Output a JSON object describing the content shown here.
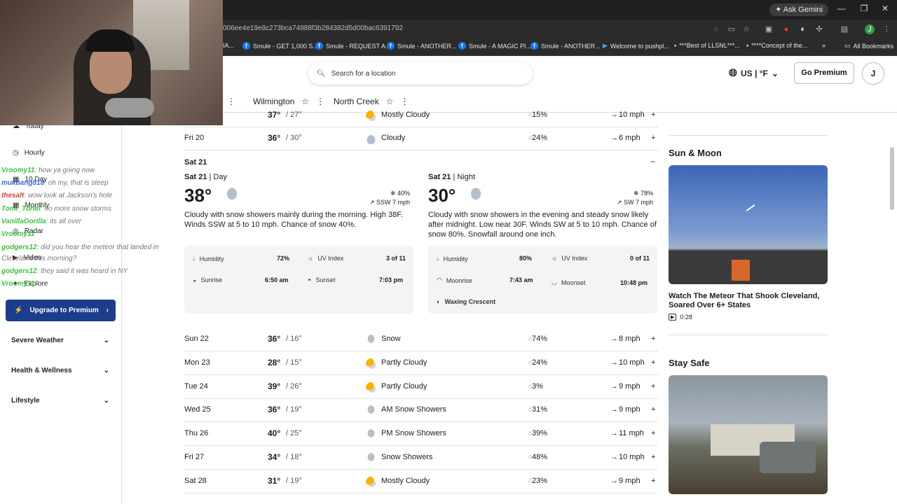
{
  "browser": {
    "ask_gemini": "Ask Gemini",
    "url": "006ee4e19e8c273bca74888f3b284382d5d00bac6391792",
    "bookmarks": [
      "IA...",
      "Smule - GET 1,000 S...",
      "Smule - REQUEST A...",
      "Smule - ANOTHER...",
      "Smule - A MAGIC PI...",
      "Smule - ANOTHER...",
      "Welcome to pushpl...",
      "***Best of LLSNL***...",
      "****Concept of the..."
    ],
    "all_bookmarks": "All Bookmarks",
    "profile_initial": "J"
  },
  "header": {
    "search_placeholder": "Search for a location",
    "units": "US | °F",
    "go_premium": "Go Premium",
    "avatar": "J"
  },
  "locations": [
    "Wilmington",
    "North Creek"
  ],
  "sidebar": {
    "nav": [
      {
        "label": "Today",
        "icon": "cloud-icon"
      },
      {
        "label": "Hourly",
        "icon": "clock-icon"
      },
      {
        "label": "10 Day",
        "icon": "calendar-icon"
      },
      {
        "label": "Monthly",
        "icon": "calendar-grid-icon"
      },
      {
        "label": "Radar",
        "icon": "radar-icon"
      },
      {
        "label": "Video",
        "icon": "video-icon"
      },
      {
        "label": "Explore",
        "icon": "explore-icon"
      }
    ],
    "upgrade": "Upgrade to Premium",
    "accordions": [
      "Severe Weather",
      "Health & Wellness",
      "Lifestyle"
    ]
  },
  "chat": [
    {
      "user": "Vroomy11",
      "msg": ": how ya going now",
      "color": "#3fbf3f"
    },
    {
      "user": "mukbang818",
      "msg": ": oh my, that is steep",
      "color": "#3b6ad1"
    },
    {
      "user": "thesalt",
      "msg": ": wow look at Jackson's hole",
      "color": "#d04040"
    },
    {
      "user": "Tomi_Toriel",
      "msg": ": no more snow storms",
      "color": "#3fbf3f"
    },
    {
      "user": "VanillaGorilla",
      "msg": ": its all over",
      "color": "#3fbf3f"
    },
    {
      "user": "Vroomy11",
      "msg": "",
      "color": "#3fbf3f"
    },
    {
      "user": "godgers12",
      "msg": ": did you hear the meteor that landed in",
      "color": "#3fbf3f"
    },
    {
      "user": "",
      "msg": "Cleveland this morning?",
      "color": "#777"
    },
    {
      "user": "godgers12",
      "msg": ": they said it was heard in NY",
      "color": "#3fbf3f"
    },
    {
      "user": "Vroomy11",
      "msg": "",
      "color": "#3fbf3f"
    }
  ],
  "forecast_top": [
    {
      "day": "",
      "hi": "37°",
      "lo": "/ 27°",
      "cond": "Mostly Cloudy",
      "precip": "15%",
      "wind": "10 mph",
      "icon": "partly-cloudy"
    },
    {
      "day": "Fri 20",
      "hi": "36°",
      "lo": "/ 30°",
      "cond": "Cloudy",
      "precip": "24%",
      "wind": "6 mph",
      "icon": "cloudy"
    }
  ],
  "expanded": {
    "label": "Sat 21",
    "day": {
      "head": "Sat 21",
      "part": "Day",
      "temp": "38°",
      "precip": "40%",
      "wind": "SSW 7 mph",
      "desc": "Cloudy with snow showers mainly during the morning. High 38F. Winds SSW at 5 to 10 mph. Chance of snow 40%.",
      "humidity_label": "Humidity",
      "humidity": "72%",
      "uv_label": "UV Index",
      "uv": "3 of 11",
      "sunrise_label": "Sunrise",
      "sunrise": "6:50 am",
      "sunset_label": "Sunset",
      "sunset": "7:03 pm"
    },
    "night": {
      "head": "Sat 21",
      "part": "Night",
      "temp": "30°",
      "precip": "78%",
      "wind": "SW 7 mph",
      "desc": "Cloudy with snow showers in the evening and steady snow likely after midnight. Low near 30F. Winds SW at 5 to 10 mph. Chance of snow 80%. Snowfall around one inch.",
      "humidity_label": "Humidity",
      "humidity": "80%",
      "uv_label": "UV Index",
      "uv": "0 of 11",
      "moonrise_label": "Moonrise",
      "moonrise": "7:43 am",
      "moonset_label": "Moonset",
      "moonset": "10:48 pm",
      "moon_phase": "Waxing Crescent"
    }
  },
  "forecast": [
    {
      "day": "Sun 22",
      "hi": "36°",
      "lo": "/ 16°",
      "cond": "Snow",
      "precip": "74%",
      "wind": "8 mph",
      "icon": "snow"
    },
    {
      "day": "Mon 23",
      "hi": "28°",
      "lo": "/ 15°",
      "cond": "Partly Cloudy",
      "precip": "24%",
      "wind": "10 mph",
      "icon": "sunny"
    },
    {
      "day": "Tue 24",
      "hi": "39°",
      "lo": "/ 26°",
      "cond": "Partly Cloudy",
      "precip": "3%",
      "wind": "9 mph",
      "icon": "sunny"
    },
    {
      "day": "Wed 25",
      "hi": "36°",
      "lo": "/ 19°",
      "cond": "AM Snow Showers",
      "precip": "31%",
      "wind": "9 mph",
      "icon": "snow"
    },
    {
      "day": "Thu 26",
      "hi": "40°",
      "lo": "/ 25°",
      "cond": "PM Snow Showers",
      "precip": "39%",
      "wind": "11 mph",
      "icon": "snow"
    },
    {
      "day": "Fri 27",
      "hi": "34°",
      "lo": "/ 18°",
      "cond": "Snow Showers",
      "precip": "48%",
      "wind": "10 mph",
      "icon": "snow"
    },
    {
      "day": "Sat 28",
      "hi": "31°",
      "lo": "/ 19°",
      "cond": "Mostly Cloudy",
      "precip": "23%",
      "wind": "9 mph",
      "icon": "sunny"
    }
  ],
  "right": {
    "sun_moon": "Sun & Moon",
    "video_title": "Watch The Meteor That Shook Cleveland, Soared Over 6+ States",
    "video_duration": "0:28",
    "stay_safe": "Stay Safe"
  },
  "colors": {
    "accent": "#1c3d8c",
    "chrome": "#2b2b2b"
  }
}
